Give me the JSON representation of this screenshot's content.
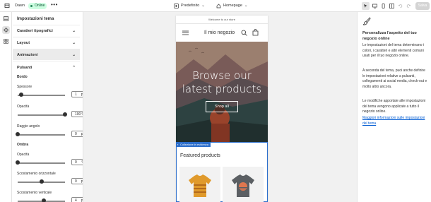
{
  "topbar": {
    "back_icon": "exit-icon",
    "store_name": "Dawn",
    "status_badge": "Online",
    "more_label": "•••",
    "theme_selector": "Predefinito",
    "page_selector": "Homepage",
    "save_label": "Salva",
    "device_icons": [
      "inspector-icon",
      "desktop-icon",
      "mobile-icon",
      "fullscreen-icon"
    ]
  },
  "rail": {
    "icons": [
      "sections-icon",
      "settings-icon",
      "apps-icon"
    ]
  },
  "panel": {
    "title": "Impostazioni tema",
    "sections": {
      "typography": "Caratteri tipografici",
      "layout": "Layout",
      "animations": "Animazioni",
      "buttons": "Pulsanti"
    },
    "border_label": "Bordo",
    "thickness_label": "Spessore",
    "thickness_value": "1",
    "thickness_unit": "px",
    "thickness_fraction": 0.08,
    "opacity_label": "Opacità",
    "opacity_value": "100",
    "opacity_unit": "%",
    "opacity_fraction": 1.0,
    "radius_label": "Raggio angolo",
    "radius_value": "0",
    "radius_unit": "px",
    "radius_fraction": 0.0,
    "shadow_label": "Ombra",
    "shadow_opacity_label": "Opacità",
    "shadow_opacity_value": "0",
    "shadow_opacity_unit": "%",
    "shadow_opacity_fraction": 0.0,
    "horiz_offset_label": "Scostamento orizzontale",
    "horiz_offset_value": "0",
    "horiz_offset_unit": "px",
    "horiz_offset_fraction": 0.5,
    "vert_offset_label": "Scostamento verticale",
    "vert_offset_value": "4",
    "vert_offset_unit": "px",
    "vert_offset_fraction": 0.55
  },
  "preview": {
    "announcement": "Welcome to our store",
    "logo": "Il mio negozio",
    "hero_title_line1": "Browse our",
    "hero_title_line2": "latest products",
    "hero_button": "Shop all",
    "collection_tag": "Collezione in evidenza",
    "featured_title": "Featured products"
  },
  "info": {
    "icon": "paintbrush-icon",
    "heading": "Personalizza l'aspetto del tuo negozio online",
    "p1": "Le impostazioni del tema determinano i colori, i caratteri e altri elementi comuni usati per il tuo negozio online.",
    "p2": "A seconda del tema, puoi anche definire le impostazioni relative a pulsanti, collegamenti ai social media, check-out e molto altro ancora.",
    "p3": "Le modifiche apportate alle impostazioni del tema vengono applicate a tutto il negozio online.",
    "link": "Maggiori informazioni sulle impostazioni del tema"
  },
  "colors": {
    "accent": "#2c6ecb",
    "online_badge_bg": "#cdfee1",
    "link": "#005bd3"
  }
}
